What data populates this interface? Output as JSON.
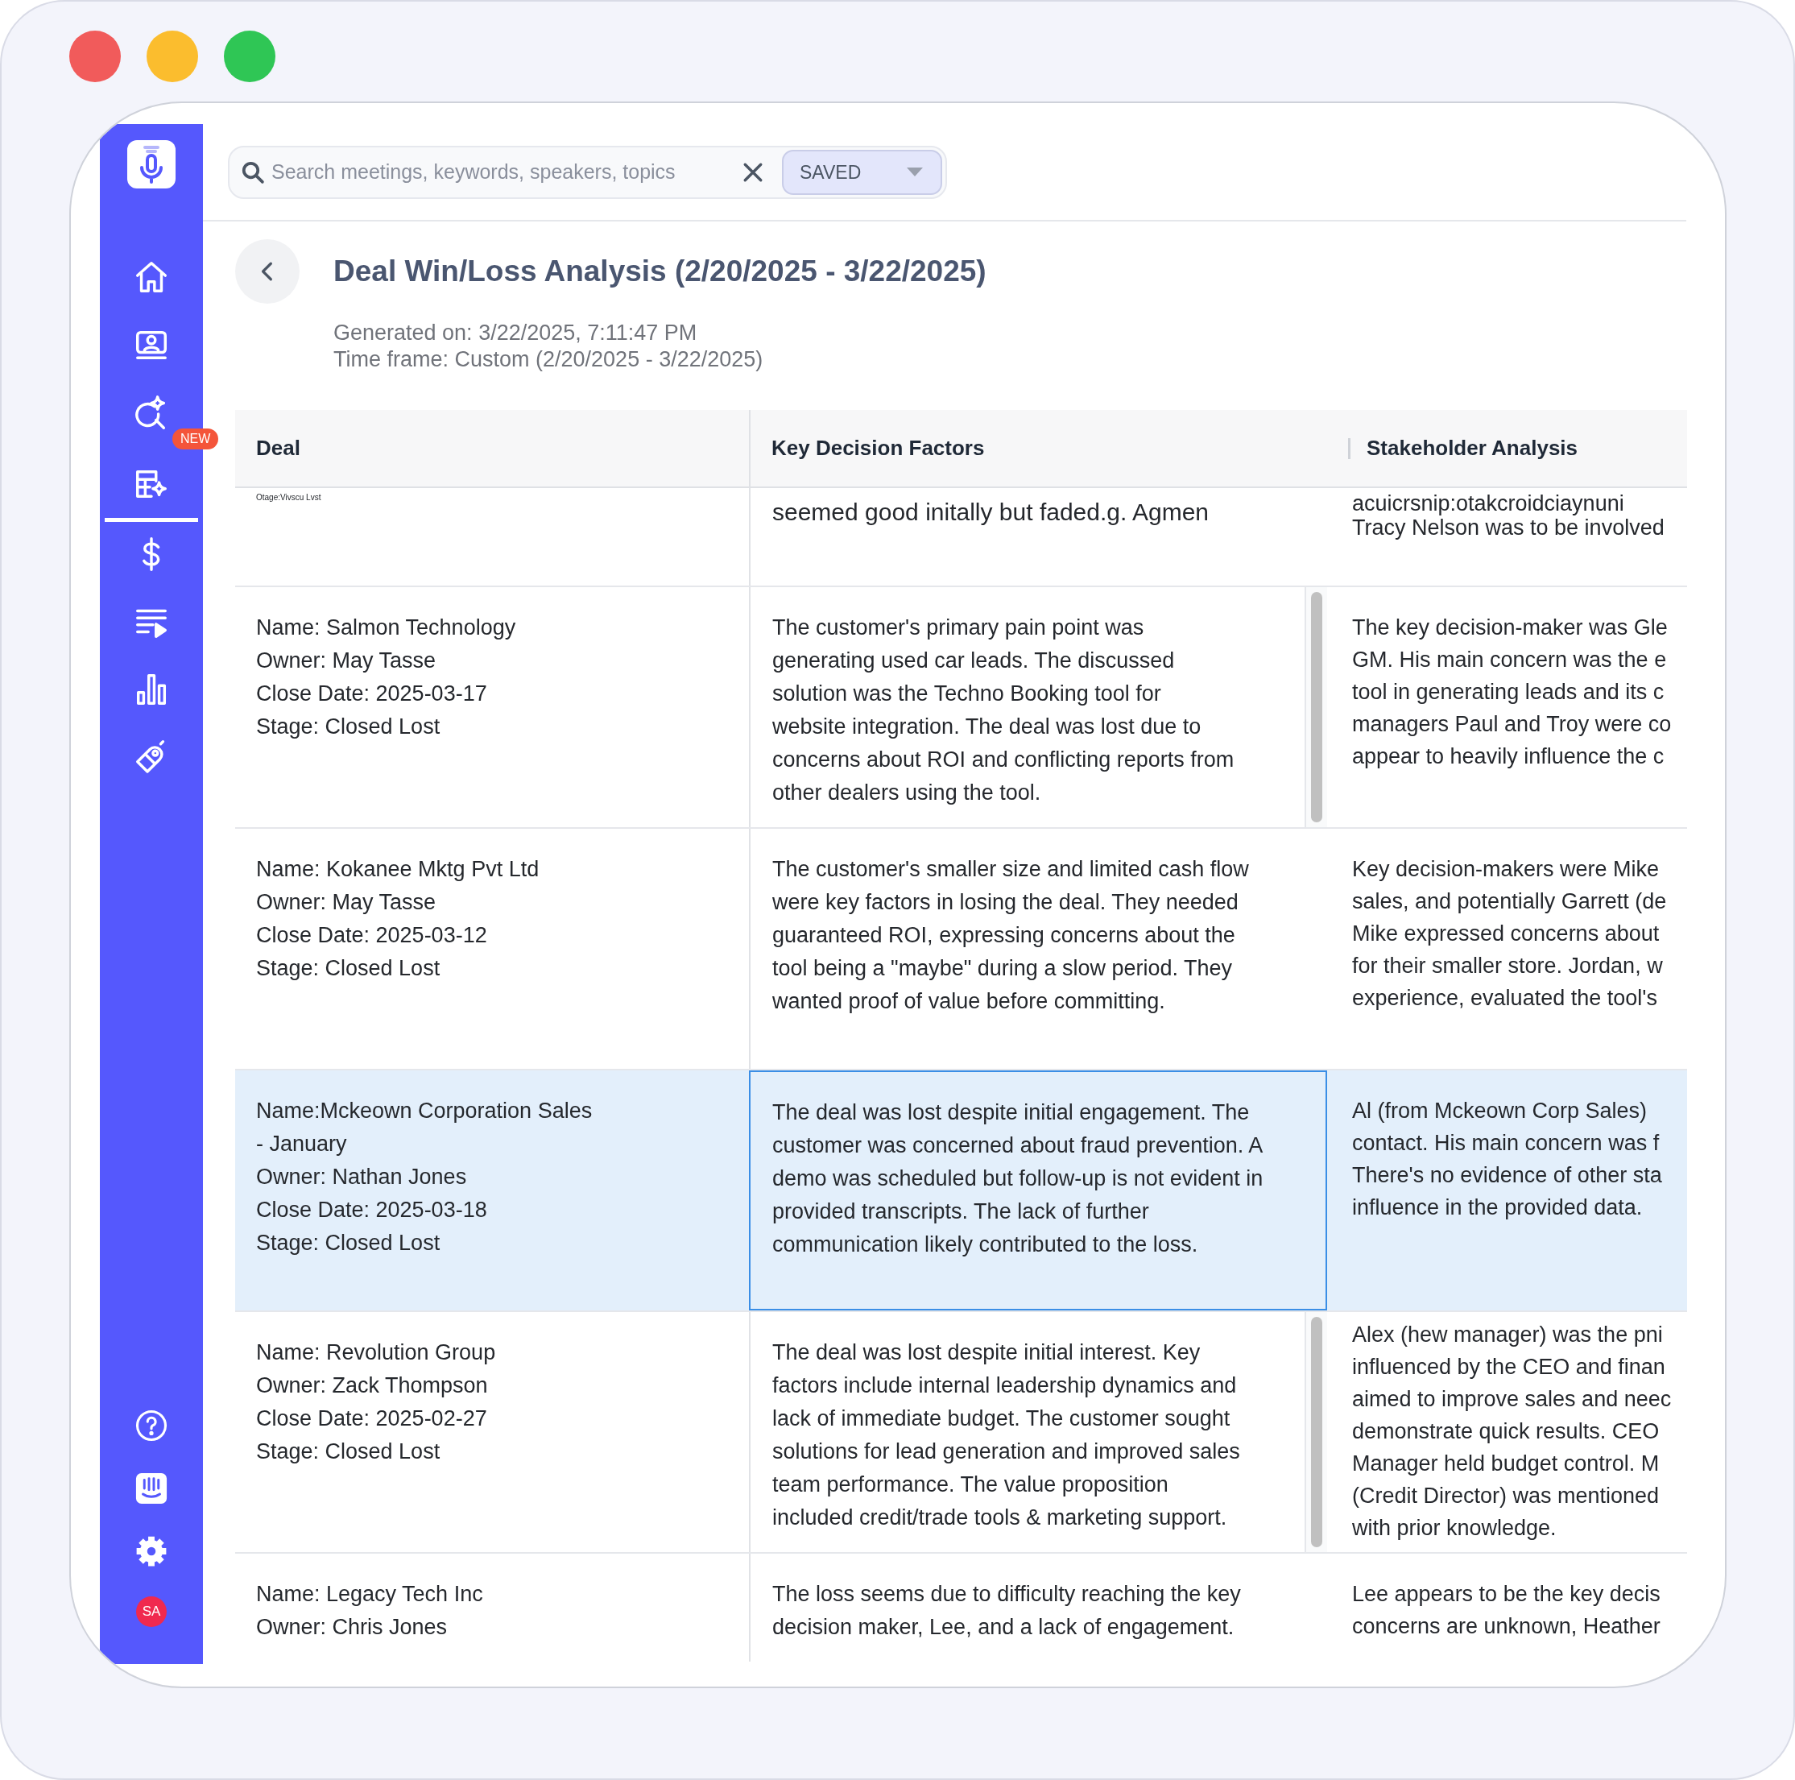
{
  "window": {
    "controls": [
      {
        "color": "#f15b5b"
      },
      {
        "color": "#fbbd2e"
      },
      {
        "color": "#2fc655"
      }
    ]
  },
  "sidebar": {
    "nav_items": [
      {
        "kind": "home",
        "selected": false
      },
      {
        "kind": "meetings",
        "selected": false
      },
      {
        "kind": "search",
        "selected": false
      },
      {
        "kind": "reports",
        "selected": true,
        "badge": "NEW"
      },
      {
        "kind": "deals",
        "selected": false
      },
      {
        "kind": "playlists",
        "selected": false
      },
      {
        "kind": "analytics",
        "selected": false
      },
      {
        "kind": "coaching",
        "selected": false
      }
    ],
    "footer_items": [
      {
        "kind": "help"
      },
      {
        "kind": "chat"
      },
      {
        "kind": "settings"
      },
      {
        "kind": "avatar",
        "initials": "SA"
      }
    ]
  },
  "search": {
    "placeholder": "Search meetings, keywords, speakers, topics",
    "filter": "SAVED"
  },
  "report": {
    "title": "Deal Win/Loss Analysis (2/20/2025 - 3/22/2025)",
    "generated": "Generated on: 3/22/2025, 7:11:47 PM",
    "time_frame": "Time frame: Custom (2/20/2025 - 3/22/2025)"
  },
  "table": {
    "columns": [
      "Deal",
      "Key Decision Factors",
      "Stakeholder Analysis"
    ],
    "rows": [
      {
        "kind": "partial",
        "selected": false,
        "scrollbar": false,
        "deal": "Otage:Vivscu Lvst",
        "key_decision_factors": "seemed good initally but faded.g. Agmen",
        "stakeholder_analysis": "acuicrsnip:otakcroidciaynuni\nTracy Nelson was to be involved"
      },
      {
        "kind": "full",
        "selected": false,
        "scrollbar": true,
        "deal": "Name: Salmon Technology\nOwner: May Tasse\nClose Date: 2025-03-17\nStage: Closed Lost",
        "key_decision_factors": "The customer's primary pain point was\ngenerating used car leads. The discussed\nsolution was the Techno Booking tool for\nwebsite integration. The deal was lost due to\nconcerns about ROI and conflicting reports from\nother dealers using the tool.",
        "stakeholder_analysis": "The key decision-maker was Gle\nGM. His main concern was the e\ntool in generating leads and its c\nmanagers Paul and Troy were co\nappear to heavily influence the c"
      },
      {
        "kind": "full",
        "selected": false,
        "scrollbar": false,
        "deal": "Name: Kokanee Mktg Pvt Ltd\nOwner: May Tasse\nClose Date: 2025-03-12\nStage: Closed Lost",
        "key_decision_factors": "The customer's smaller size and limited cash flow\nwere key factors in losing the deal. They needed\nguaranteed ROI, expressing concerns about the\ntool being a \"maybe\" during a slow period. They\nwanted proof of value before committing.",
        "stakeholder_analysis": "Key decision-makers were Mike\nsales, and potentially Garrett (de\nMike expressed concerns about\nfor their smaller store. Jordan, w\nexperience, evaluated the tool's"
      },
      {
        "kind": "full",
        "selected": true,
        "scrollbar": false,
        "deal": "Name:Mckeown Corporation Sales\n- January\nOwner: Nathan Jones\nClose Date: 2025-03-18\nStage: Closed Lost",
        "key_decision_factors": "The deal was lost despite initial engagement.  The\ncustomer was concerned about fraud prevention. A\ndemo was scheduled but follow-up is not evident in\nprovided transcripts. The lack of further\ncommunication likely contributed to the loss.",
        "stakeholder_analysis": "Al (from Mckeown Corp Sales)\ncontact. His main concern was f\nThere's no evidence of other sta\ninfluence in the provided data."
      },
      {
        "kind": "full",
        "selected": false,
        "scrollbar": true,
        "deal": "Name: Revolution Group\nOwner: Zack Thompson\nClose Date: 2025-02-27\nStage: Closed Lost",
        "key_decision_factors": "The deal was lost despite initial interest. Key\nfactors include internal leadership dynamics and\nlack of immediate budget. The customer sought\nsolutions for lead generation and improved sales\nteam performance. The value proposition\nincluded credit/trade tools & marketing support.",
        "stakeholder_analysis": "Alex (hew manager) was the pni\ninfluenced by the CEO and finan\naimed to improve sales and neec\ndemonstrate quick results. CEO\nManager held budget control. M\n(Credit Director) was mentioned\nwith prior knowledge."
      },
      {
        "kind": "full",
        "selected": false,
        "scrollbar": false,
        "deal": "Name: Legacy Tech Inc\nOwner: Chris Jones",
        "key_decision_factors": "The loss seems due to difficulty reaching the key\ndecision maker, Lee, and a lack of engagement.",
        "stakeholder_analysis": "Lee appears to be the key decis\nconcerns are unknown, Heather"
      }
    ]
  }
}
